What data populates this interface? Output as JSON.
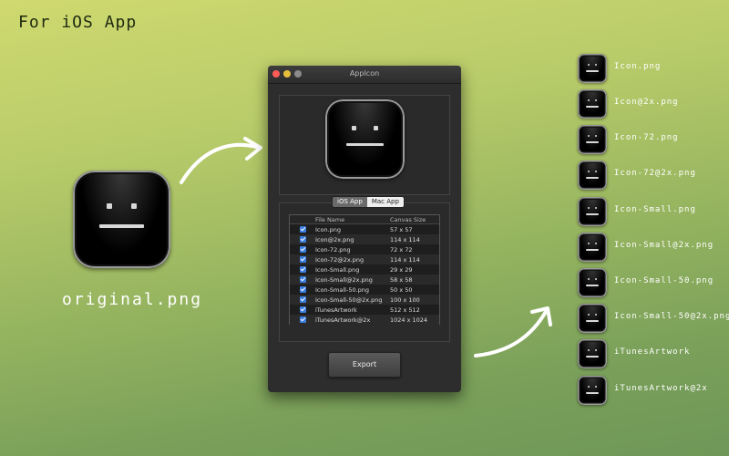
{
  "heading": "For iOS App",
  "original_label": "original.png",
  "window": {
    "title": "AppIcon",
    "segments": [
      {
        "label": "iOS App",
        "selected": true
      },
      {
        "label": "Mac App",
        "selected": false
      }
    ],
    "table": {
      "headers": {
        "name": "File Name",
        "size": "Canvas Size"
      },
      "rows": [
        {
          "name": "Icon.png",
          "size": "57 x 57"
        },
        {
          "name": "Icon@2x.png",
          "size": "114 x 114"
        },
        {
          "name": "Icon-72.png",
          "size": "72 x 72"
        },
        {
          "name": "Icon-72@2x.png",
          "size": "114 x 114"
        },
        {
          "name": "Icon-Small.png",
          "size": "29 x 29"
        },
        {
          "name": "Icon-Small@2x.png",
          "size": "58 x 58"
        },
        {
          "name": "Icon-Small-50.png",
          "size": "50 x 50"
        },
        {
          "name": "Icon-Small-50@2x.png",
          "size": "100 x 100"
        },
        {
          "name": "iTunesArtwork",
          "size": "512 x 512"
        },
        {
          "name": "iTunesArtwork@2x",
          "size": "1024 x 1024"
        }
      ]
    },
    "export_label": "Export"
  },
  "outputs": [
    "Icon.png",
    "Icon@2x.png",
    "Icon-72.png",
    "Icon-72@2x.png",
    "Icon-Small.png",
    "Icon-Small@2x.png",
    "Icon-Small-50.png",
    "Icon-Small-50@2x.png",
    "iTunesArtwork",
    "iTunesArtwork@2x"
  ],
  "colors": {
    "checkbox": "#3a7de0",
    "close_dot": "#fc5b57",
    "minimize_dot": "#e5bf3c"
  }
}
